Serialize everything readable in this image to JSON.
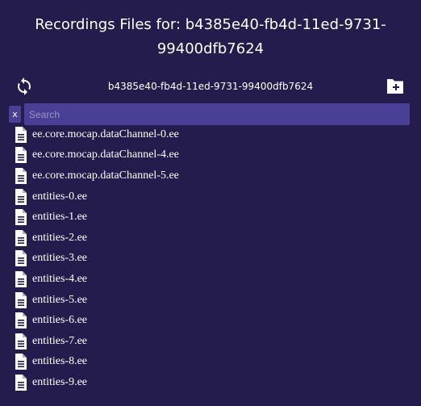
{
  "header": {
    "title_line1": "Recordings Files for: b4385e40-fb4d-11ed-9731-",
    "title_line2": "99400dfb7624"
  },
  "toolbar": {
    "refresh_icon": "refresh-icon",
    "current_folder": "b4385e40-fb4d-11ed-9731-99400dfb7624",
    "new_folder_icon": "folder-plus-icon"
  },
  "search": {
    "clear_label": "x",
    "placeholder": "Search",
    "value": ""
  },
  "files": [
    {
      "name": "ee.core.mocap.dataChannel-0.ee",
      "icon": "file-icon"
    },
    {
      "name": "ee.core.mocap.dataChannel-4.ee",
      "icon": "file-icon"
    },
    {
      "name": "ee.core.mocap.dataChannel-5.ee",
      "icon": "file-icon"
    },
    {
      "name": "entities-0.ee",
      "icon": "file-icon"
    },
    {
      "name": "entities-1.ee",
      "icon": "file-icon"
    },
    {
      "name": "entities-2.ee",
      "icon": "file-icon"
    },
    {
      "name": "entities-3.ee",
      "icon": "file-icon"
    },
    {
      "name": "entities-4.ee",
      "icon": "file-icon"
    },
    {
      "name": "entities-5.ee",
      "icon": "file-icon"
    },
    {
      "name": "entities-6.ee",
      "icon": "file-icon"
    },
    {
      "name": "entities-7.ee",
      "icon": "file-icon"
    },
    {
      "name": "entities-8.ee",
      "icon": "file-icon"
    },
    {
      "name": "entities-9.ee",
      "icon": "file-icon"
    }
  ],
  "colors": {
    "background": "#231c4c",
    "input_background": "#4a3f96",
    "text": "#ffffff"
  }
}
